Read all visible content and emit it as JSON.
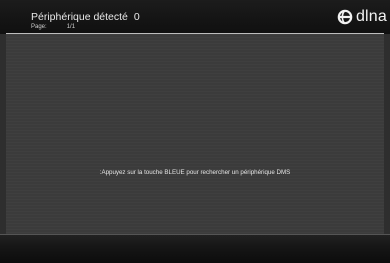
{
  "header": {
    "title": "Périphérique détecté",
    "device_count": "0",
    "page_label": "Page:",
    "page_value": "1/1",
    "logo_text": "dlna",
    "logo_icon": "dlna-logo-icon"
  },
  "main": {
    "message": ":Appuyez sur la touche BLEUE pour rechercher un périphérique DMS"
  },
  "colors": {
    "background": "#3b3b3b",
    "header": "#141414",
    "text": "#e8e8e8"
  }
}
